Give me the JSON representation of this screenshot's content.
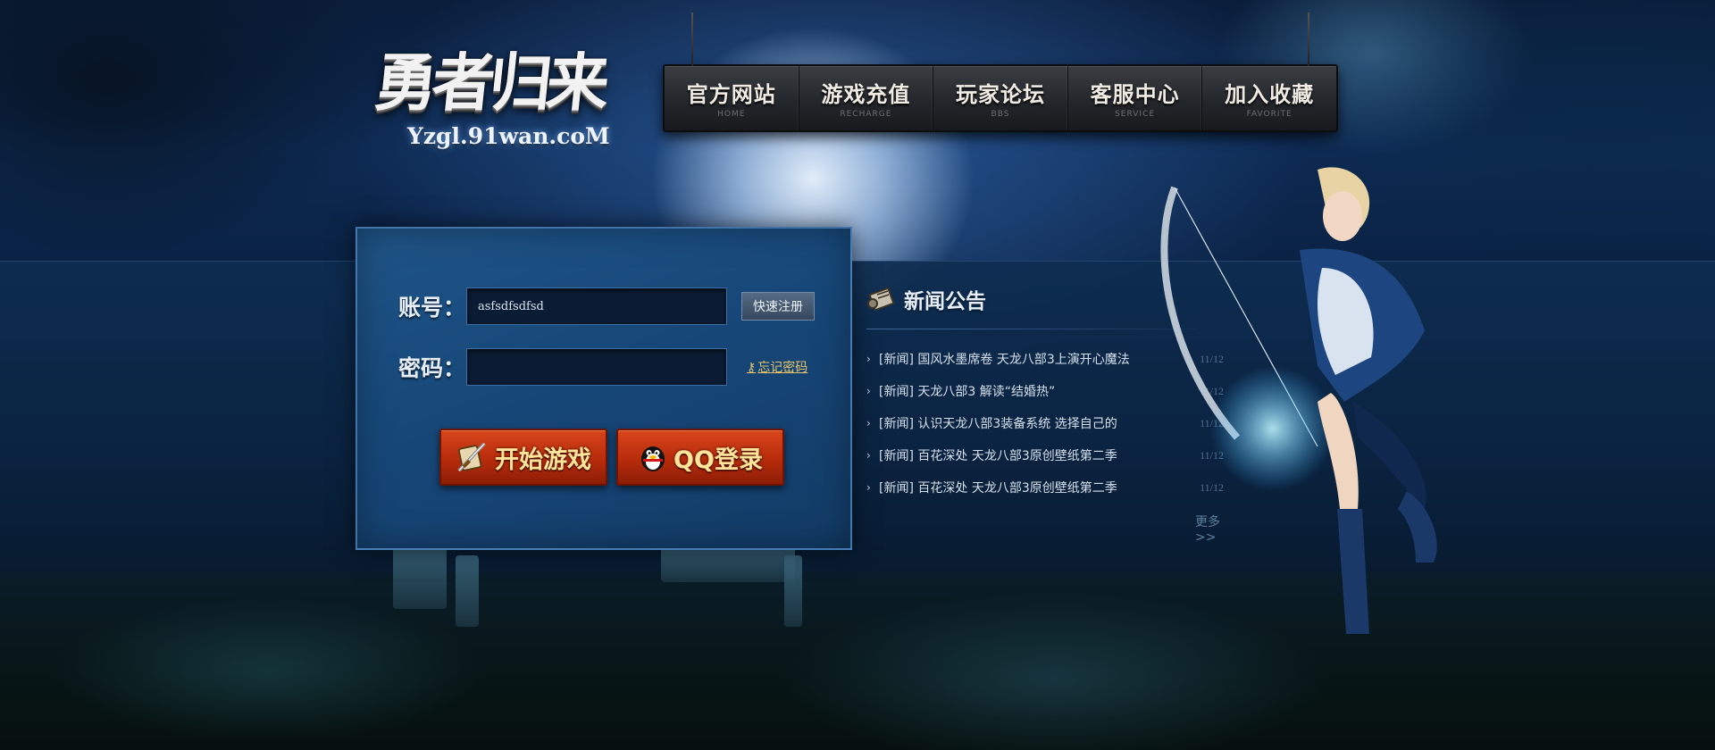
{
  "logo": {
    "title": "勇者归来",
    "url": "Yzgl.91wan.coM"
  },
  "nav": [
    {
      "label": "官方网站",
      "sub": "HOME"
    },
    {
      "label": "游戏充值",
      "sub": "RECHARGE"
    },
    {
      "label": "玩家论坛",
      "sub": "BBS"
    },
    {
      "label": "客服中心",
      "sub": "SERVICE"
    },
    {
      "label": "加入收藏",
      "sub": "FAVORITE"
    }
  ],
  "login": {
    "account_label": "账号：",
    "account_value": "asfsdfsdfsd",
    "password_label": "密码：",
    "password_value": "",
    "register_button": "快速注册",
    "forgot_link": "忘记密码",
    "start_button": "开始游戏",
    "qq_button": "QQ登录"
  },
  "news": {
    "title": "新闻公告",
    "items": [
      {
        "text": "[新闻] 国风水墨席卷 天龙八部3上演开心魔法",
        "date": "11/12"
      },
      {
        "text": "[新闻] 天龙八部3 解读“结婚热”",
        "date": "11/12"
      },
      {
        "text": "[新闻] 认识天龙八部3装备系统 选择自己的",
        "date": "11/12"
      },
      {
        "text": "[新闻] 百花深处 天龙八部3原创壁纸第二季",
        "date": "11/12"
      },
      {
        "text": "[新闻] 百花深处 天龙八部3原创壁纸第二季",
        "date": "11/12"
      }
    ],
    "more": "更多>>"
  }
}
